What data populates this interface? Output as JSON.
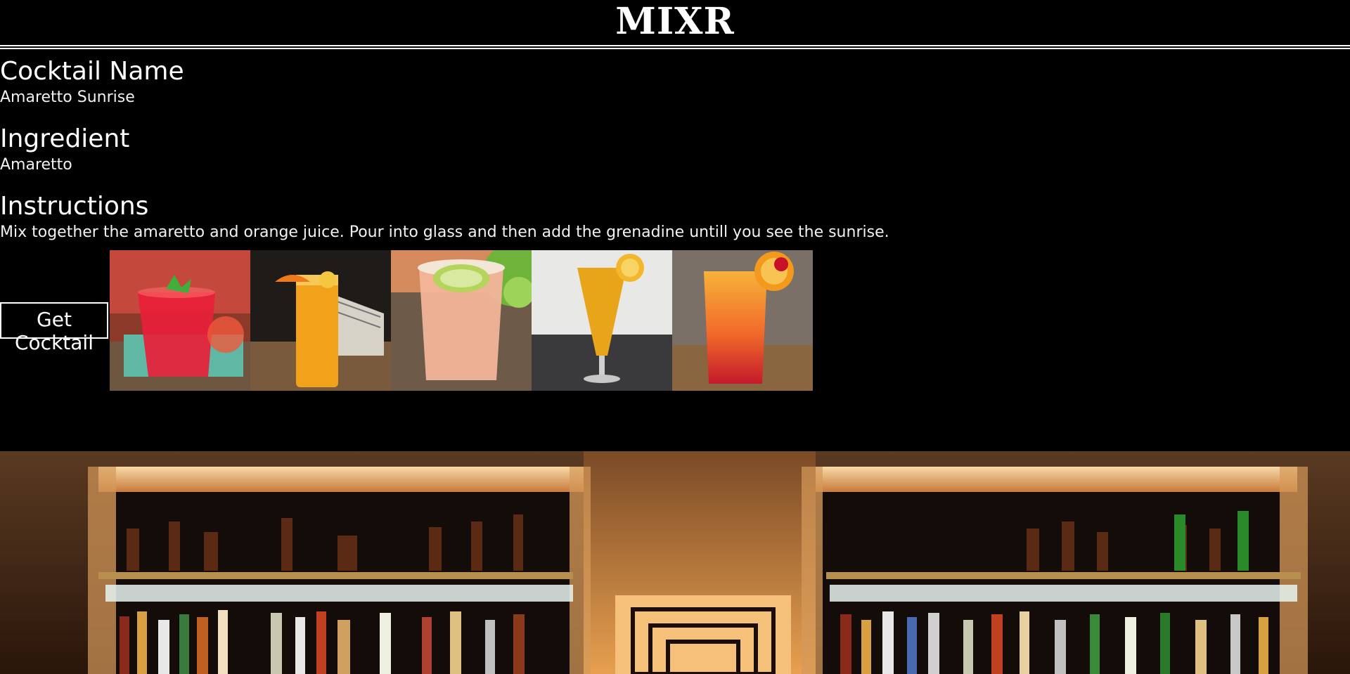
{
  "header": {
    "title": "MIXR"
  },
  "cocktail": {
    "name_heading": "Cocktail Name",
    "name": "Amaretto Sunrise",
    "ingredient_heading": "Ingredient",
    "ingredient": "Amaretto",
    "instructions_heading": "Instructions",
    "instructions": "Mix together the amaretto and orange juice. Pour into glass and then add the grenadine untill you see the sunrise."
  },
  "actions": {
    "get_cocktail_label": "Get Cocktail"
  },
  "thumbnails": [
    {
      "name": "red-cocktail-mint-photo"
    },
    {
      "name": "orange-juice-glass-photo"
    },
    {
      "name": "peach-margarita-lime-photo"
    },
    {
      "name": "orange-flute-cocktail-photo"
    },
    {
      "name": "tequila-sunrise-photo"
    }
  ],
  "background": {
    "name": "bar-shelves-photo"
  }
}
